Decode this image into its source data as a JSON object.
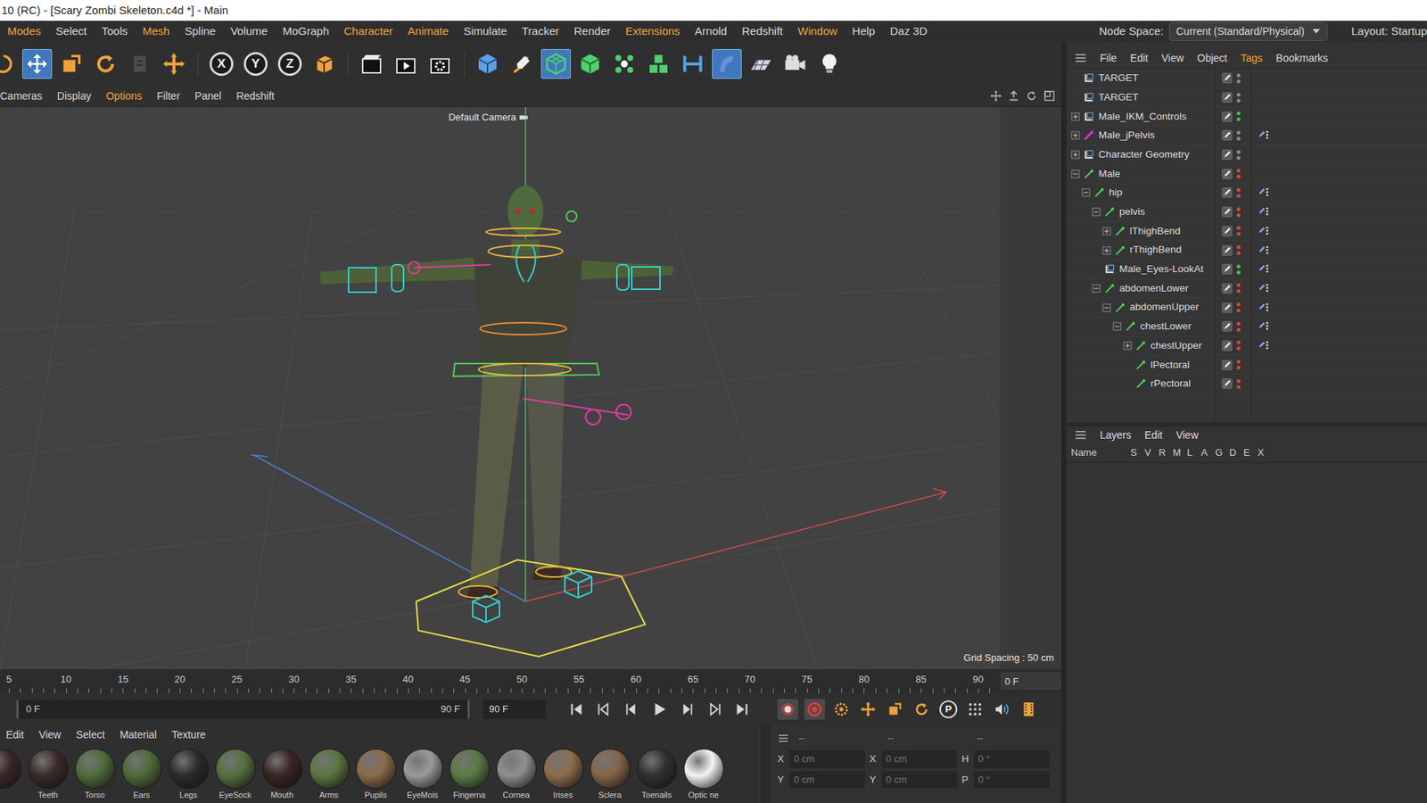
{
  "window": {
    "title": "10 (RC) - [Scary Zombi Skeleton.c4d *] - Main"
  },
  "menu": [
    {
      "label": "Modes",
      "highlighted": true
    },
    {
      "label": "Select",
      "highlighted": false
    },
    {
      "label": "Tools",
      "highlighted": false
    },
    {
      "label": "Mesh",
      "highlighted": true
    },
    {
      "label": "Spline",
      "highlighted": false
    },
    {
      "label": "Volume",
      "highlighted": false
    },
    {
      "label": "MoGraph",
      "highlighted": false
    },
    {
      "label": "Character",
      "highlighted": true
    },
    {
      "label": "Animate",
      "highlighted": true
    },
    {
      "label": "Simulate",
      "highlighted": false
    },
    {
      "label": "Tracker",
      "highlighted": false
    },
    {
      "label": "Render",
      "highlighted": false
    },
    {
      "label": "Extensions",
      "highlighted": true
    },
    {
      "label": "Arnold",
      "highlighted": false
    },
    {
      "label": "Redshift",
      "highlighted": false
    },
    {
      "label": "Window",
      "highlighted": true
    },
    {
      "label": "Help",
      "highlighted": false
    },
    {
      "label": "Daz 3D",
      "highlighted": false
    }
  ],
  "node_space": {
    "label": "Node Space:",
    "value": "Current (Standard/Physical)"
  },
  "layout": {
    "label": "Layout:",
    "value": "Startup"
  },
  "toolbar": {
    "tools": [
      {
        "kind": "select",
        "selected": false,
        "disabled": false
      },
      {
        "kind": "move",
        "selected": true,
        "disabled": false
      },
      {
        "kind": "scale",
        "selected": false,
        "disabled": false
      },
      {
        "kind": "rotate",
        "selected": false,
        "disabled": false
      },
      {
        "kind": "recent",
        "selected": false,
        "disabled": true
      },
      {
        "kind": "transform",
        "selected": false,
        "disabled": false
      },
      {
        "kind": "axis",
        "label": "X",
        "selected": false,
        "disabled": false
      },
      {
        "kind": "axis",
        "label": "Y",
        "selected": false,
        "disabled": false
      },
      {
        "kind": "axis",
        "label": "Z",
        "selected": false,
        "disabled": false
      },
      {
        "kind": "coord",
        "selected": false,
        "disabled": false
      },
      {
        "kind": "render-view",
        "selected": false,
        "disabled": false
      },
      {
        "kind": "render",
        "selected": false,
        "disabled": false
      },
      {
        "kind": "render-settings",
        "selected": false,
        "disabled": false
      },
      {
        "kind": "cube",
        "selected": false,
        "disabled": false
      },
      {
        "kind": "pen",
        "selected": false,
        "disabled": false
      },
      {
        "kind": "subdiv",
        "selected": true,
        "disabled": false
      },
      {
        "kind": "box",
        "selected": false,
        "disabled": false
      },
      {
        "kind": "cloner",
        "selected": false,
        "disabled": false
      },
      {
        "kind": "cubes",
        "selected": false,
        "disabled": false
      },
      {
        "kind": "symmetry",
        "selected": false,
        "disabled": false
      },
      {
        "kind": "deformer",
        "selected": true,
        "disabled": false
      },
      {
        "kind": "floor",
        "selected": false,
        "disabled": false
      },
      {
        "kind": "camera",
        "selected": false,
        "disabled": false
      },
      {
        "kind": "light",
        "selected": false,
        "disabled": false
      }
    ]
  },
  "viewport": {
    "menu": [
      {
        "label": "Cameras",
        "highlighted": false
      },
      {
        "label": "Display",
        "highlighted": false
      },
      {
        "label": "Options",
        "highlighted": true
      },
      {
        "label": "Filter",
        "highlighted": false
      },
      {
        "label": "Panel",
        "highlighted": false
      },
      {
        "label": "Redshift",
        "highlighted": false
      }
    ],
    "camera": "Default Camera",
    "grid_spacing": "Grid Spacing : 50 cm"
  },
  "objects": {
    "menu": [
      {
        "label": "File",
        "highlighted": false
      },
      {
        "label": "Edit",
        "highlighted": false
      },
      {
        "label": "View",
        "highlighted": false
      },
      {
        "label": "Object",
        "highlighted": false
      },
      {
        "label": "Tags",
        "highlighted": true
      },
      {
        "label": "Bookmarks",
        "highlighted": false
      }
    ],
    "items": [
      {
        "name": "TARGET",
        "depth": 0,
        "children": false,
        "expanded": false,
        "kind": "null",
        "tag": false,
        "color": "#8a8a8a"
      },
      {
        "name": "TARGET",
        "depth": 0,
        "children": false,
        "expanded": false,
        "kind": "null",
        "tag": false,
        "color": "#8a8a8a"
      },
      {
        "name": "Male_IKM_Controls",
        "depth": 0,
        "children": true,
        "expanded": false,
        "kind": "null",
        "tag": false,
        "color": "#3fc060"
      },
      {
        "name": "Male_jPelvis",
        "depth": 0,
        "children": true,
        "expanded": false,
        "kind": "pelvis",
        "tag": true,
        "color": "#8a8a8a"
      },
      {
        "name": "Character Geometry",
        "depth": 0,
        "children": true,
        "expanded": false,
        "kind": "null",
        "tag": false,
        "color": "#8a8a8a"
      },
      {
        "name": "Male",
        "depth": 0,
        "children": true,
        "expanded": true,
        "kind": "joint",
        "tag": false,
        "color": "#d9473f"
      },
      {
        "name": "hip",
        "depth": 1,
        "children": true,
        "expanded": true,
        "kind": "joint",
        "tag": true,
        "color": "#d9473f"
      },
      {
        "name": "pelvis",
        "depth": 2,
        "children": true,
        "expanded": true,
        "kind": "joint",
        "tag": true,
        "color": "#d9473f"
      },
      {
        "name": "lThighBend",
        "depth": 3,
        "children": true,
        "expanded": false,
        "kind": "joint",
        "tag": true,
        "color": "#d9473f"
      },
      {
        "name": "rThighBend",
        "depth": 3,
        "children": true,
        "expanded": false,
        "kind": "joint",
        "tag": true,
        "color": "#d9473f"
      },
      {
        "name": "Male_Eyes-LookAt",
        "depth": 2,
        "children": false,
        "expanded": false,
        "kind": "null",
        "tag": true,
        "color": "#3fc060"
      },
      {
        "name": "abdomenLower",
        "depth": 2,
        "children": true,
        "expanded": true,
        "kind": "joint",
        "tag": true,
        "color": "#d9473f"
      },
      {
        "name": "abdomenUpper",
        "depth": 3,
        "children": true,
        "expanded": true,
        "kind": "joint",
        "tag": true,
        "color": "#d9473f"
      },
      {
        "name": "chestLower",
        "depth": 4,
        "children": true,
        "expanded": true,
        "kind": "joint",
        "tag": true,
        "color": "#d9473f"
      },
      {
        "name": "chestUpper",
        "depth": 5,
        "children": true,
        "expanded": false,
        "kind": "joint",
        "tag": true,
        "color": "#d9473f"
      },
      {
        "name": "lPectoral",
        "depth": 5,
        "children": false,
        "expanded": false,
        "kind": "joint",
        "tag": false,
        "color": "#d9473f"
      },
      {
        "name": "rPectoral",
        "depth": 5,
        "children": false,
        "expanded": false,
        "kind": "joint",
        "tag": false,
        "color": "#d9473f"
      }
    ]
  },
  "layers": {
    "menu": [
      {
        "label": "Layers",
        "highlighted": false
      },
      {
        "label": "Edit",
        "highlighted": false
      },
      {
        "label": "View",
        "highlighted": false
      }
    ],
    "columns": [
      "Name",
      "S",
      "V",
      "R",
      "M",
      "L",
      "A",
      "G",
      "D",
      "E",
      "X"
    ]
  },
  "timeline": {
    "ticks": [
      "5",
      "10",
      "15",
      "20",
      "25",
      "30",
      "35",
      "40",
      "45",
      "50",
      "55",
      "60",
      "65",
      "70",
      "75",
      "80",
      "85",
      "90"
    ],
    "frame": "0 F",
    "range_start": "0 F",
    "range_end": "90 F",
    "end_frame": "90 F",
    "key_label": "P",
    "autokey": {
      "on": true
    }
  },
  "materials": {
    "menu": [
      "Edit",
      "View",
      "Select",
      "Material",
      "Texture"
    ],
    "items": [
      {
        "name": "",
        "color": "#3a2826"
      },
      {
        "name": "Teeth",
        "color": "#3b2b28"
      },
      {
        "name": "Torso",
        "color": "#4f6b3a"
      },
      {
        "name": "Ears",
        "color": "#4e6a38"
      },
      {
        "name": "Legs",
        "color": "#2b2b2b"
      },
      {
        "name": "EyeSock",
        "color": "#55703d"
      },
      {
        "name": "Mouth",
        "color": "#3a2422"
      },
      {
        "name": "Arms",
        "color": "#5c7540"
      },
      {
        "name": "Pupils",
        "color": "#8a6a4a"
      },
      {
        "name": "EyeMois",
        "color": "#9a9a9a"
      },
      {
        "name": "Fingerna",
        "color": "#5a7a44"
      },
      {
        "name": "Cornea",
        "color": "#8f8f8f"
      },
      {
        "name": "Irises",
        "color": "#8d6c4c"
      },
      {
        "name": "Sclera",
        "color": "#85654a"
      },
      {
        "name": "Toenails",
        "color": "#2f3030"
      },
      {
        "name": "Optic ne",
        "color": "#f4f4f4"
      }
    ]
  },
  "coordinates": {
    "headers": [
      "--",
      "--",
      "--"
    ],
    "rows": [
      [
        {
          "axis": "X",
          "value": "0 cm"
        },
        {
          "axis": "X",
          "value": "0 cm"
        },
        {
          "axis": "H",
          "value": "0 °"
        }
      ],
      [
        {
          "axis": "Y",
          "value": "0 cm"
        },
        {
          "axis": "Y",
          "value": "0 cm"
        },
        {
          "axis": "P",
          "value": "0 °"
        }
      ]
    ]
  }
}
